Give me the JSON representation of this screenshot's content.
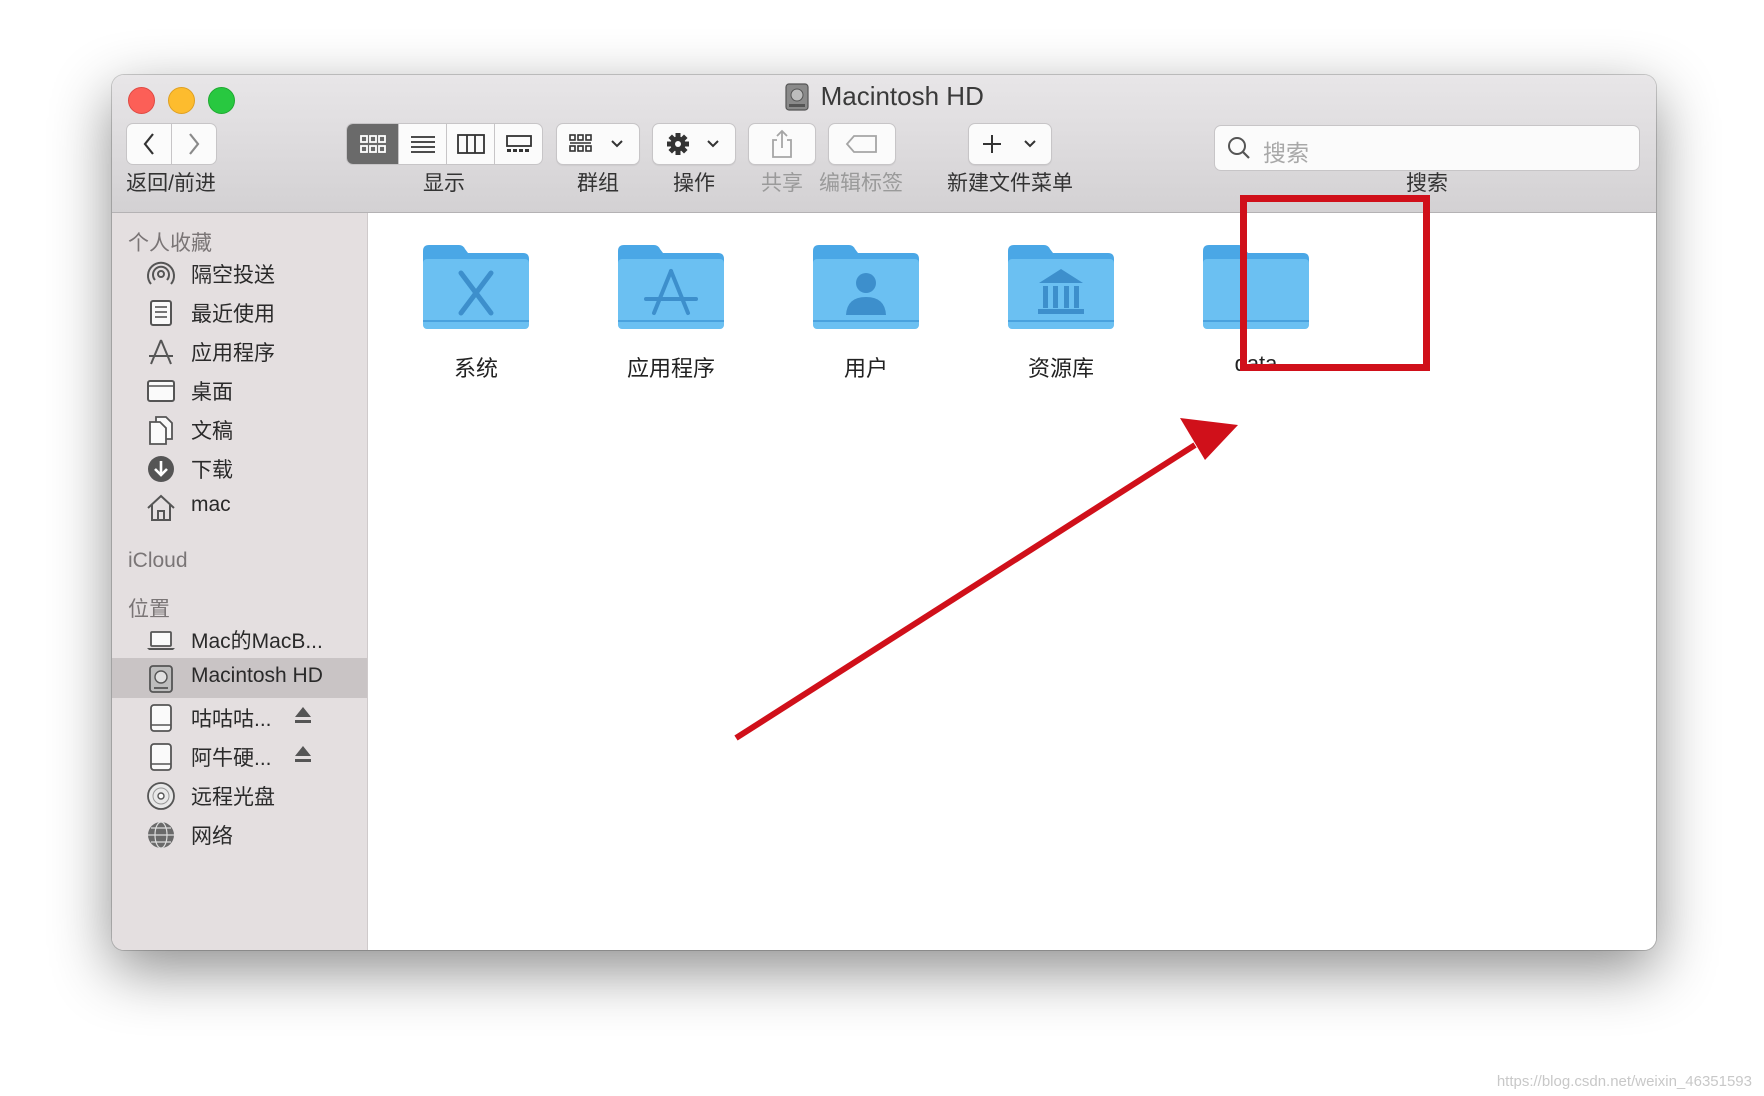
{
  "window": {
    "title": "Macintosh HD"
  },
  "toolbar": {
    "nav_label": "返回/前进",
    "view_label": "显示",
    "group_label": "群组",
    "action_label": "操作",
    "share_label": "共享",
    "tags_label": "编辑标签",
    "new_menu_label": "新建文件菜单",
    "search_label": "搜索",
    "search_placeholder": "搜索"
  },
  "sidebar": {
    "favorites_title": "个人收藏",
    "favorites": [
      {
        "label": "隔空投送",
        "icon": "airdrop-icon"
      },
      {
        "label": "最近使用",
        "icon": "recents-icon"
      },
      {
        "label": "应用程序",
        "icon": "applications-icon"
      },
      {
        "label": "桌面",
        "icon": "desktop-icon"
      },
      {
        "label": "文稿",
        "icon": "documents-icon"
      },
      {
        "label": "下载",
        "icon": "downloads-icon"
      },
      {
        "label": "mac",
        "icon": "home-icon"
      }
    ],
    "icloud_title": "iCloud",
    "locations_title": "位置",
    "locations": [
      {
        "label": "Mac的MacB...",
        "icon": "laptop-icon"
      },
      {
        "label": "Macintosh HD",
        "icon": "hard-drive-icon",
        "selected": true
      },
      {
        "label": "咕咕咕...",
        "icon": "external-drive-icon",
        "ejectable": true
      },
      {
        "label": "阿牛硬...",
        "icon": "external-drive-icon",
        "ejectable": true
      },
      {
        "label": "远程光盘",
        "icon": "remote-disc-icon"
      },
      {
        "label": "网络",
        "icon": "network-icon"
      }
    ]
  },
  "content": {
    "items": [
      {
        "label": "系统",
        "icon": "system-folder-icon"
      },
      {
        "label": "应用程序",
        "icon": "applications-folder-icon"
      },
      {
        "label": "用户",
        "icon": "users-folder-icon"
      },
      {
        "label": "资源库",
        "icon": "library-folder-icon"
      },
      {
        "label": "data",
        "icon": "folder-icon",
        "highlighted": true
      }
    ]
  },
  "annotation": {
    "highlight_color": "#d0101a"
  },
  "watermark": "https://blog.csdn.net/weixin_46351593"
}
